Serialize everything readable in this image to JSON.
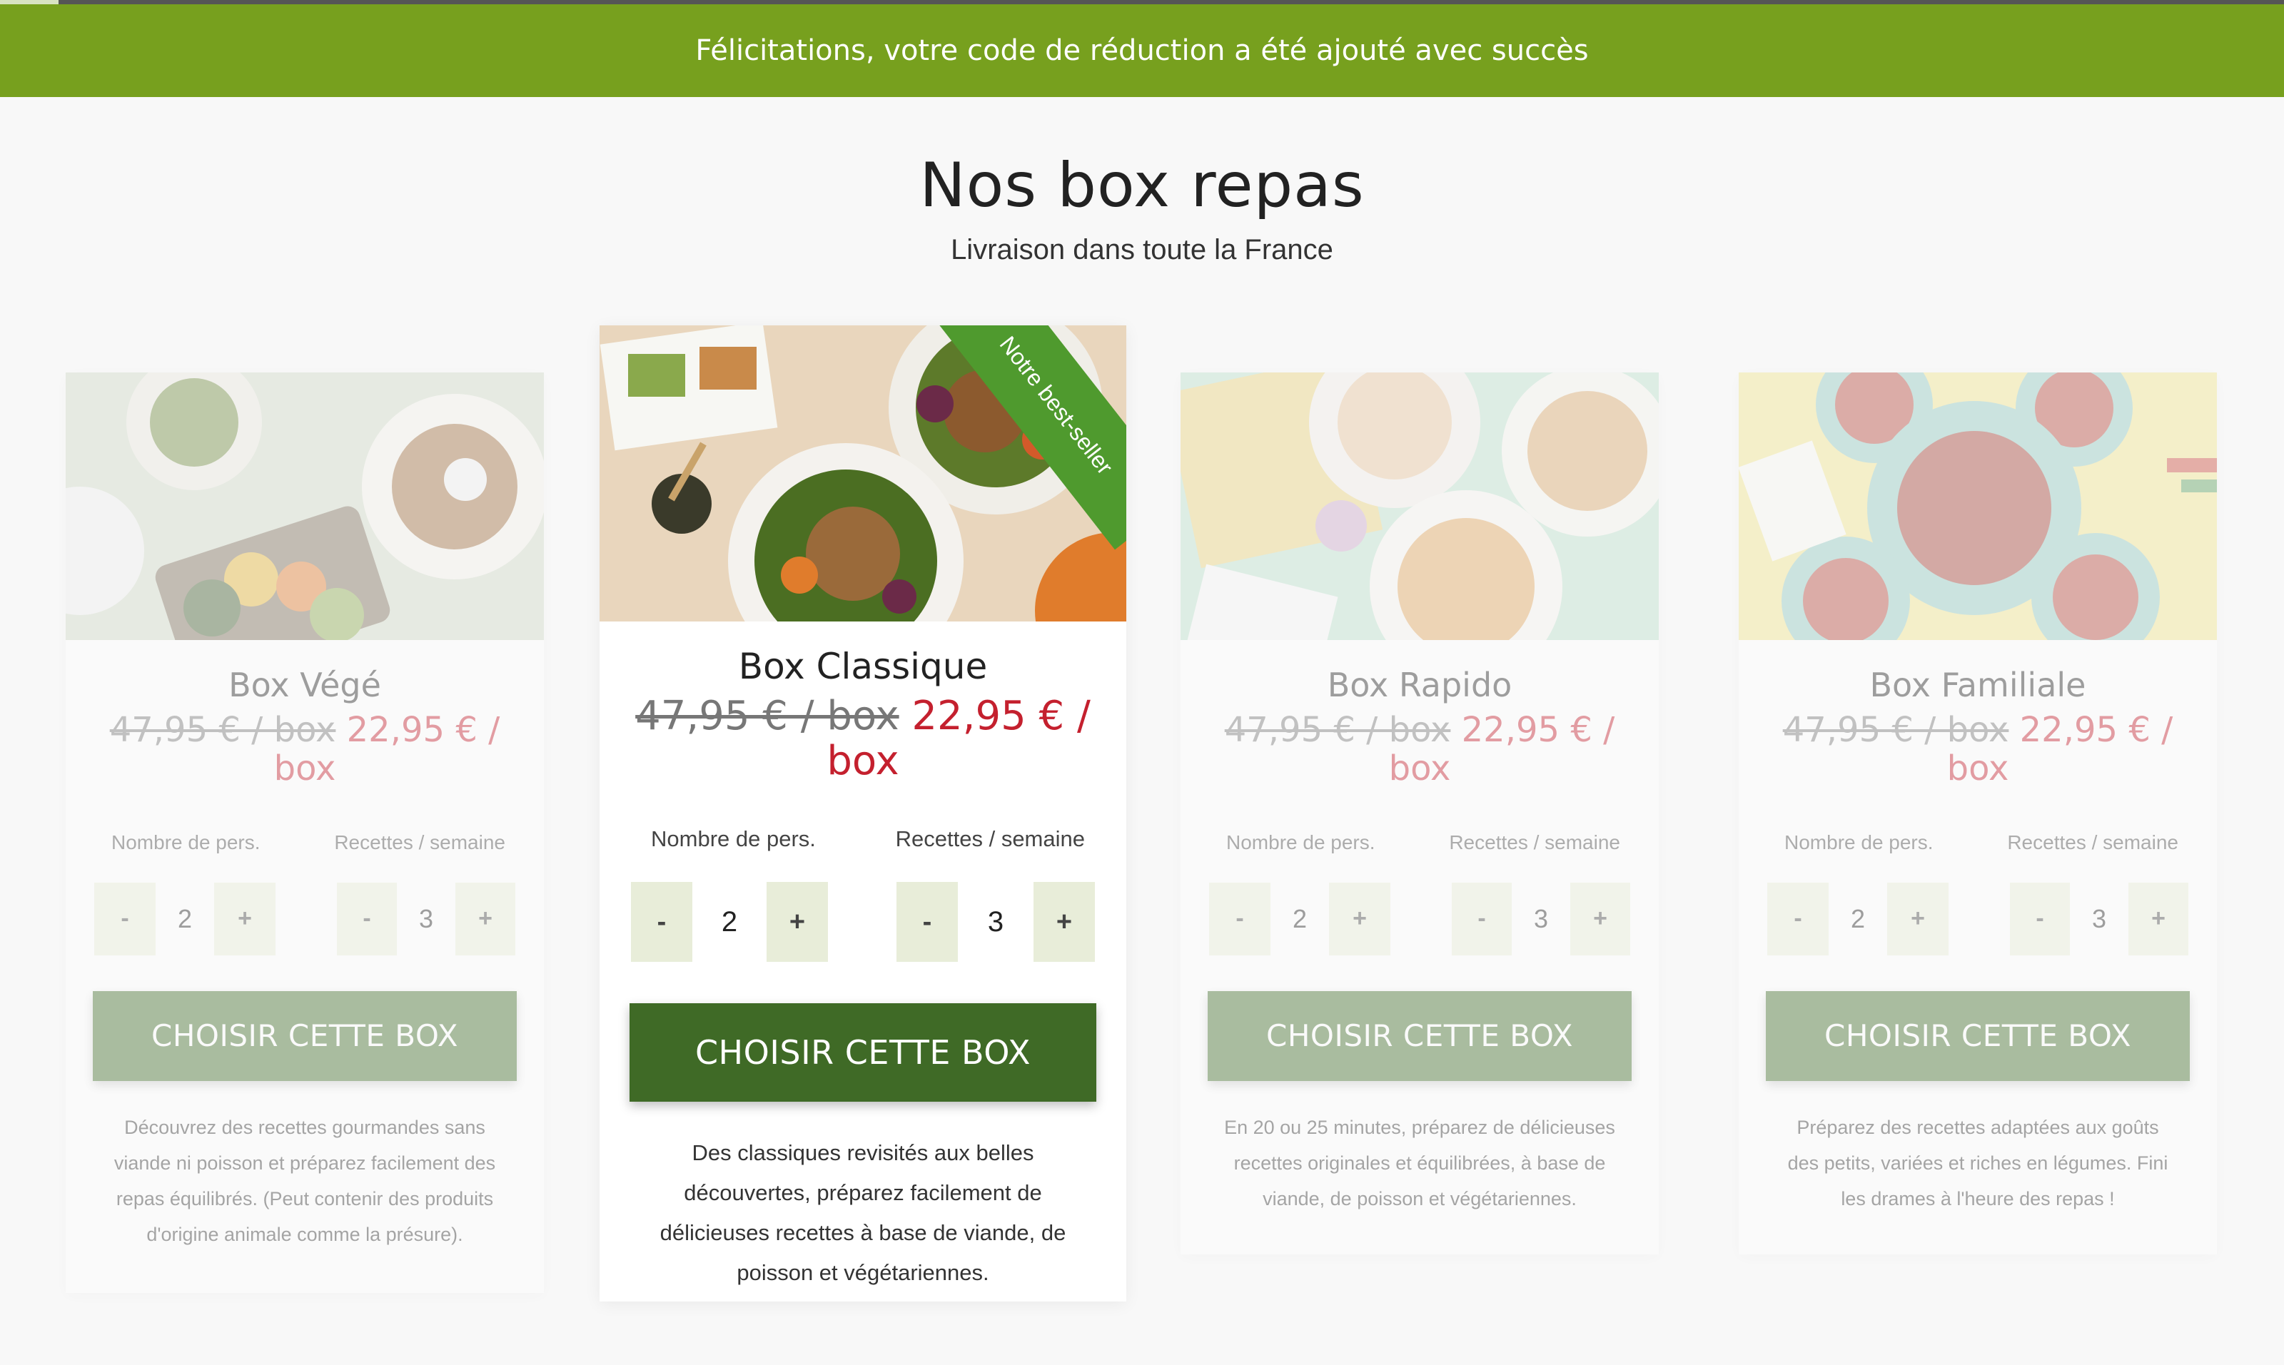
{
  "banner": {
    "message": "Félicitations, votre code de réduction a été ajouté avec succès"
  },
  "hero": {
    "title": "Nos box repas",
    "subtitle": "Livraison dans toute la France"
  },
  "labels": {
    "persons": "Nombre de pers.",
    "recipes": "Recettes / semaine",
    "minus": "-",
    "plus": "+",
    "cta": "CHOISIR CETTE BOX"
  },
  "cards": [
    {
      "title": "Box Végé",
      "old_price": "47,95 € / box",
      "new_price": "22,95 € /",
      "unit": "box",
      "persons": "2",
      "recipes": "3",
      "description": "Découvrez des recettes gourmandes sans viande ni poisson et préparez facilement des repas équilibrés. (Peut contenir des produits d'origine animale comme la présure)."
    },
    {
      "title": "Box Classique",
      "old_price": "47,95 € / box",
      "new_price": "22,95 € /",
      "unit": "box",
      "persons": "2",
      "recipes": "3",
      "badge": "Notre best-seller",
      "description": "Des classiques revisités aux belles découvertes, préparez facilement de délicieuses recettes à base de viande, de poisson et végétariennes."
    },
    {
      "title": "Box Rapido",
      "old_price": "47,95 € / box",
      "new_price": "22,95 € /",
      "unit": "box",
      "persons": "2",
      "recipes": "3",
      "description": "En 20 ou 25 minutes, préparez de délicieuses recettes originales et équilibrées, à base de viande, de poisson et végétariennes."
    },
    {
      "title": "Box Familiale",
      "old_price": "47,95 € / box",
      "new_price": "22,95 € /",
      "unit": "box",
      "persons": "2",
      "recipes": "3",
      "description": "Préparez des recettes adaptées aux goûts des petits, variées et riches en légumes. Fini les drames à l'heure des repas !"
    }
  ],
  "colors": {
    "banner": "#77a01e",
    "cta": "#3f6a26",
    "price": "#c4202e",
    "stepper_button": "#e8edd9",
    "ribbon": "#4f9a2e"
  }
}
